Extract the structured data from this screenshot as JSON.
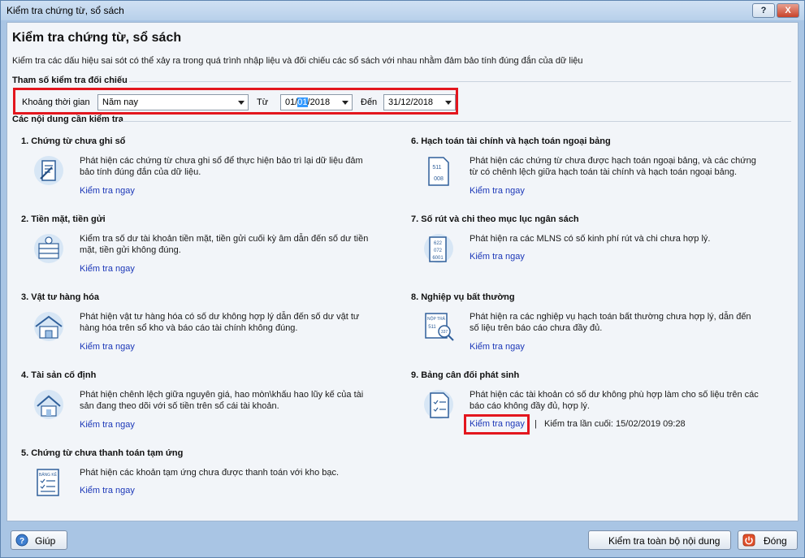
{
  "window": {
    "title": "Kiểm tra chứng từ, sổ sách",
    "help_glyph": "?",
    "close_glyph": "X"
  },
  "page": {
    "heading": "Kiểm tra chứng từ, sổ sách",
    "description": "Kiểm tra các dấu hiệu sai sót có thể xảy ra trong quá trình nhập liệu và đối chiếu các sổ sách với nhau nhằm đảm bảo tính đúng đắn của dữ liệu"
  },
  "params": {
    "section_title": "Tham số kiểm tra đối chiếu",
    "period_label": "Khoảng thời gian",
    "period_value": "Năm nay",
    "from_label": "Từ",
    "from_value_pre": "01/",
    "from_value_sel": "01",
    "from_value_post": "/2018",
    "to_label": "Đến",
    "to_value": "31/12/2018"
  },
  "checks": {
    "section_title": "Các nội dung cần kiểm tra",
    "link_label": "Kiểm tra ngay",
    "items": [
      {
        "title": "1. Chứng từ chưa ghi sổ",
        "text": "Phát hiện các chứng từ chưa ghi sổ để thực hiện bảo trì lại dữ liệu đảm bảo tính đúng đắn của dữ liệu.",
        "icon": "document-quill-icon"
      },
      {
        "title": "2. Tiền mặt, tiền gửi",
        "text": "Kiểm tra số dư tài khoản tiền mặt, tiền gửi cuối kỳ âm dẫn đến số dư tiền mặt, tiền gửi không đúng.",
        "icon": "cash-stack-icon"
      },
      {
        "title": "3. Vật tư hàng hóa",
        "text": "Phát hiện vật tư hàng hóa có số dư không hợp lý dẫn đến số dư vật tư hàng hóa trên sổ kho và báo cáo tài chính không đúng.",
        "icon": "warehouse-icon"
      },
      {
        "title": "4. Tài sản cố định",
        "text": "Phát hiện chênh lệch giữa nguyên giá, hao mòn\\khấu hao lũy kế của tài sản đang theo dõi với số tiền trên sổ cái tài khoản.",
        "icon": "house-icon"
      },
      {
        "title": "5. Chứng từ chưa thanh toán tạm ứng",
        "text": "Phát hiện các khoản tạm ứng chưa được thanh toán với kho bạc.",
        "icon": "bang-ke-icon",
        "icon_text": "BẢNG KÊ"
      },
      {
        "title": "6. Hạch toán tài chính và hạch toán ngoại bảng",
        "text": "Phát hiện các chứng từ chưa được hạch toán ngoại bảng, và các chứng từ có chênh lệch giữa hạch toán tài chính và hạch toán ngoại bảng.",
        "icon": "ledger-codes-icon",
        "icon_text_1": "511",
        "icon_text_2": "008"
      },
      {
        "title": "7. Số rút và chi theo mục lục ngân sách",
        "text": "Phát hiện ra các MLNS có số kinh phí rút và chi chưa hợp lý.",
        "icon": "budget-codes-icon",
        "icon_text_1": "622",
        "icon_text_2": "072",
        "icon_text_3": "6001"
      },
      {
        "title": "8. Nghiệp vụ bất thường",
        "text": "Phát hiện ra các nghiệp vụ hạch toán bất thường chưa hợp lý, dẫn đến số liệu trên báo cáo chưa đầy đủ.",
        "icon": "search-document-icon",
        "icon_text_1": "NỘP TRẢ",
        "icon_text_2": "511",
        "icon_text_3": "337"
      },
      {
        "title": "9. Bảng cân đối phát sinh",
        "text": "Phát hiện các tài khoản có số dư không phù hợp làm cho số liệu trên các báo cáo không đầy đủ, hợp lý.",
        "icon": "checklist-icon",
        "separator": "|",
        "last_check": "Kiểm tra lần cuối: 15/02/2019 09:28"
      }
    ]
  },
  "footer": {
    "help_label": "Giúp",
    "check_all_label": "Kiểm tra toàn bộ nội dung",
    "close_label": "Đóng"
  }
}
